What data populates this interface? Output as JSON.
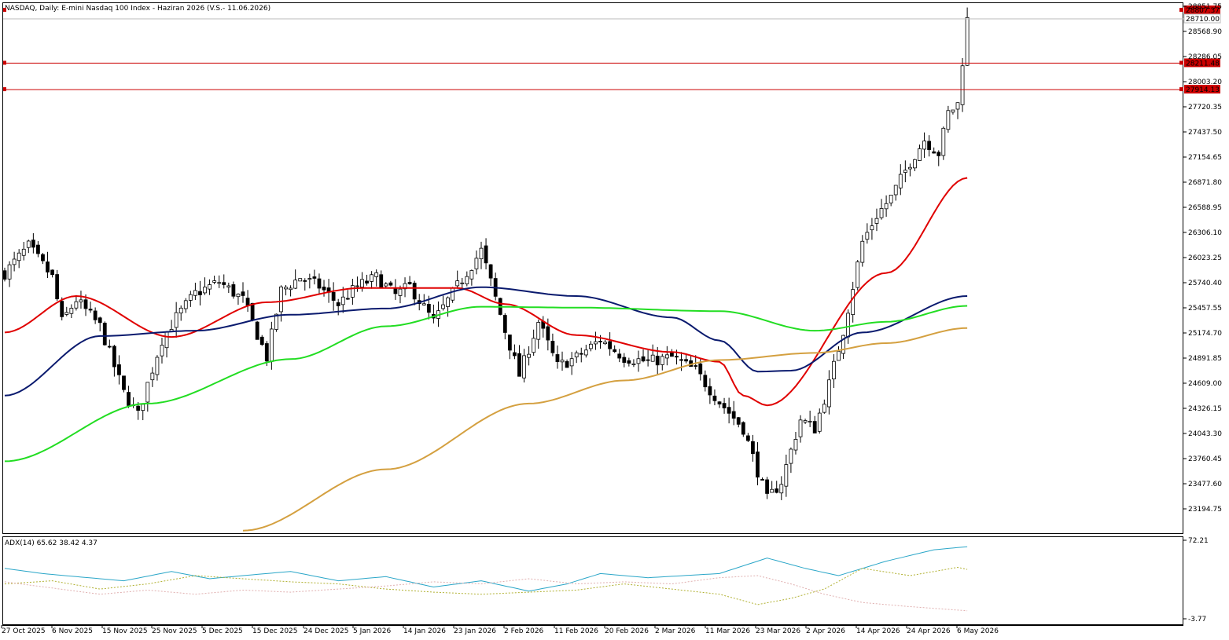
{
  "chart_data": [
    {
      "type": "candlestick",
      "title": "NASDAQ, Daily:  E-mini Nasdaq 100 Index -  Haziran 2026 (V.S.- 11.06.2026)",
      "ylim": [
        23000,
        28850
      ],
      "y_ticks": [
        "28851.75",
        "28568.90",
        "28286.05",
        "28003.20",
        "27720.35",
        "27437.50",
        "27154.65",
        "26871.80",
        "26588.95",
        "26306.10",
        "26023.25",
        "25740.40",
        "25457.55",
        "25174.70",
        "24891.85",
        "24609.00",
        "24326.15",
        "24043.30",
        "23760.45",
        "23477.60",
        "23194.75"
      ],
      "x_ticks": [
        "27 Oct 2025",
        "6 Nov 2025",
        "15 Nov 2025",
        "25 Nov 2025",
        "5 Dec 2025",
        "15 Dec 2025",
        "24 Dec 2025",
        "5 Jan 2026",
        "14 Jan 2026",
        "23 Jan 2026",
        "2 Feb 2026",
        "11 Feb 2026",
        "20 Feb 2026",
        "2 Mar 2026",
        "11 Mar 2026",
        "23 Mar 2026",
        "2 Apr 2026",
        "14 Apr 2026",
        "24 Apr 2026",
        "6 May 2026"
      ],
      "levels": [
        {
          "label": "28807.37",
          "value": 28807.37,
          "kind": "price-tag"
        },
        {
          "label": "28710.00",
          "value": 28710.0,
          "kind": "current-price"
        },
        {
          "label": "28211.48",
          "value": 28211.48,
          "kind": "horizontal-line"
        },
        {
          "label": "27914.13",
          "value": 27914.13,
          "kind": "horizontal-line"
        }
      ],
      "ma_series": [
        {
          "color": "#e00000",
          "start": 25180,
          "waypoints": [
            [
              0,
              25180
            ],
            [
              15,
              25590
            ],
            [
              35,
              25130
            ],
            [
              55,
              25520
            ],
            [
              75,
              25680
            ],
            [
              95,
              25680
            ],
            [
              105,
              25500
            ],
            [
              120,
              25150
            ],
            [
              140,
              24960
            ],
            [
              150,
              24850
            ],
            [
              155,
              24470
            ],
            [
              160,
              24360
            ],
            [
              185,
              25850
            ],
            [
              202,
              26920
            ]
          ]
        },
        {
          "color": "#0a1a6e",
          "start": 24470,
          "waypoints": [
            [
              0,
              24470
            ],
            [
              20,
              25140
            ],
            [
              40,
              25200
            ],
            [
              60,
              25380
            ],
            [
              80,
              25450
            ],
            [
              100,
              25690
            ],
            [
              120,
              25590
            ],
            [
              140,
              25350
            ],
            [
              150,
              25090
            ],
            [
              158,
              24740
            ],
            [
              165,
              24750
            ],
            [
              180,
              25180
            ],
            [
              202,
              25590
            ]
          ]
        },
        {
          "color": "#22dd22",
          "start": 23730,
          "waypoints": [
            [
              0,
              23730
            ],
            [
              30,
              24380
            ],
            [
              60,
              24880
            ],
            [
              80,
              25250
            ],
            [
              100,
              25470
            ],
            [
              120,
              25460
            ],
            [
              150,
              25420
            ],
            [
              170,
              25200
            ],
            [
              185,
              25300
            ],
            [
              202,
              25480
            ]
          ]
        },
        {
          "color": "#d4a040",
          "start": 22950,
          "waypoints": [
            [
              50,
              22950
            ],
            [
              80,
              23640
            ],
            [
              110,
              24380
            ],
            [
              130,
              24640
            ],
            [
              150,
              24870
            ],
            [
              170,
              24950
            ],
            [
              185,
              25060
            ],
            [
              202,
              25230
            ]
          ]
        }
      ],
      "candles_summary": "Daily OHLC, ~200 sessions from 27 Oct 2025 to 7 May 2026; range ~23,100 to ~28,850"
    },
    {
      "type": "line",
      "title": "ADX(14) 65.62 38.42 4.37",
      "ylim": [
        -3.77,
        72.21
      ],
      "y_ticks": [
        "72.21",
        "-3.77"
      ],
      "series": [
        {
          "color": "#2aa6c8",
          "style": "solid",
          "final": 65.62,
          "waypoints": [
            [
              0,
              45
            ],
            [
              8,
              40
            ],
            [
              15,
              37
            ],
            [
              25,
              33
            ],
            [
              35,
              42
            ],
            [
              43,
              35
            ],
            [
              50,
              38
            ],
            [
              60,
              42
            ],
            [
              70,
              33
            ],
            [
              80,
              37
            ],
            [
              90,
              27
            ],
            [
              100,
              33
            ],
            [
              110,
              23
            ],
            [
              118,
              30
            ],
            [
              125,
              40
            ],
            [
              135,
              36
            ],
            [
              150,
              40
            ],
            [
              160,
              55
            ],
            [
              168,
              45
            ],
            [
              175,
              38
            ],
            [
              185,
              52
            ],
            [
              195,
              63
            ],
            [
              202,
              66
            ]
          ]
        },
        {
          "color": "#b0b030",
          "style": "dashed",
          "final": 38.42,
          "waypoints": [
            [
              0,
              30
            ],
            [
              10,
              33
            ],
            [
              20,
              25
            ],
            [
              30,
              30
            ],
            [
              40,
              38
            ],
            [
              50,
              35
            ],
            [
              60,
              32
            ],
            [
              70,
              30
            ],
            [
              80,
              25
            ],
            [
              90,
              22
            ],
            [
              100,
              20
            ],
            [
              110,
              22
            ],
            [
              120,
              24
            ],
            [
              130,
              30
            ],
            [
              140,
              25
            ],
            [
              150,
              20
            ],
            [
              158,
              10
            ],
            [
              165,
              16
            ],
            [
              172,
              25
            ],
            [
              180,
              45
            ],
            [
              190,
              38
            ],
            [
              200,
              46
            ],
            [
              202,
              44
            ]
          ]
        },
        {
          "color": "#e0b0b0",
          "style": "dashed",
          "final": 4.37,
          "waypoints": [
            [
              0,
              32
            ],
            [
              10,
              26
            ],
            [
              20,
              20
            ],
            [
              30,
              24
            ],
            [
              40,
              20
            ],
            [
              50,
              24
            ],
            [
              60,
              22
            ],
            [
              70,
              25
            ],
            [
              80,
              28
            ],
            [
              90,
              32
            ],
            [
              100,
              30
            ],
            [
              110,
              35
            ],
            [
              120,
              30
            ],
            [
              130,
              32
            ],
            [
              140,
              30
            ],
            [
              150,
              36
            ],
            [
              158,
              38
            ],
            [
              165,
              30
            ],
            [
              172,
              20
            ],
            [
              180,
              12
            ],
            [
              190,
              8
            ],
            [
              202,
              4
            ]
          ]
        }
      ]
    }
  ]
}
